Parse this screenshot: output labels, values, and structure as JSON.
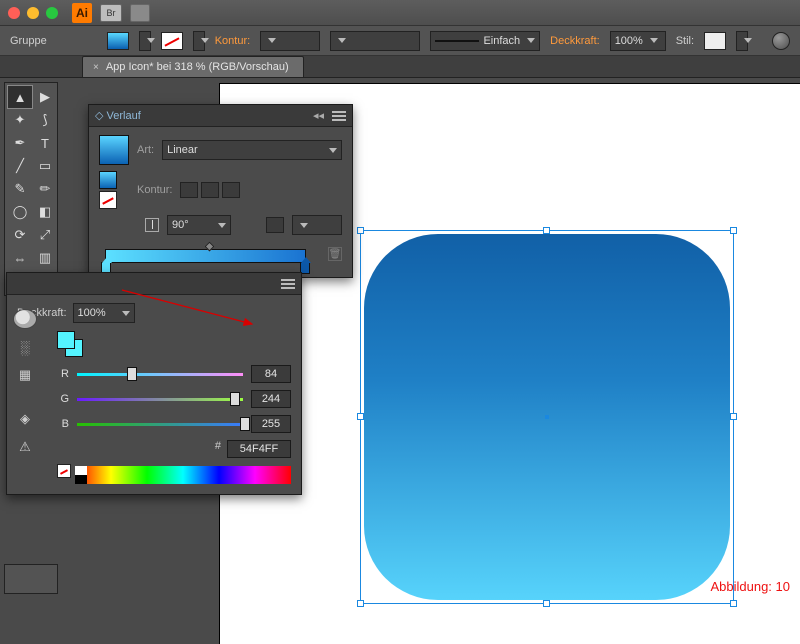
{
  "app": {
    "badge": "Ai"
  },
  "controlbar": {
    "selection_label": "Gruppe",
    "stroke_label": "Kontur:",
    "stroke_style_label": "Einfach",
    "opacity_label": "Deckkraft:",
    "opacity_value": "100%",
    "style_label": "Stil:"
  },
  "document": {
    "tab_title": "App Icon* bei 318 % (RGB/Vorschau)"
  },
  "gradient_panel": {
    "title": "Verlauf",
    "type_label": "Art:",
    "type_value": "Linear",
    "stroke_label": "Kontur:",
    "angle_value": "90°"
  },
  "color_panel": {
    "opacity_label": "Deckkraft:",
    "opacity_value": "100%",
    "channels": {
      "r": {
        "label": "R",
        "value": "84"
      },
      "g": {
        "label": "G",
        "value": "244"
      },
      "b": {
        "label": "B",
        "value": "255"
      }
    },
    "hex_prefix": "#",
    "hex_value": "54F4FF"
  },
  "figure_caption": "Abbildung: 10"
}
